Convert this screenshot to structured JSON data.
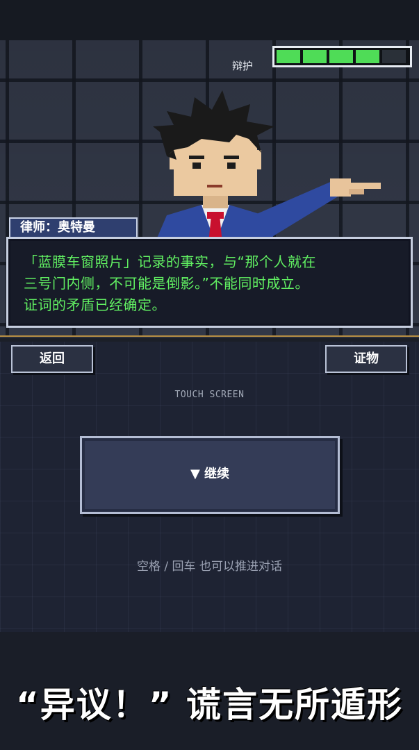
{
  "hud": {
    "defense_label": "辩护",
    "health_segments_total": 5,
    "health_segments_filled": 4,
    "health_color": "#4fdc57"
  },
  "dialog": {
    "speaker": "律师：奥特曼",
    "lines": [
      "「蓝膜车窗照片」记录的事实，与“那个人就在",
      "三号门内侧，不可能是倒影。”不能同时成立。",
      "证词的矛盾已经确定。"
    ],
    "text_color": "#61f062"
  },
  "controls": {
    "back_label": "返回",
    "evidence_label": "证物",
    "touch_hint": "TOUCH SCREEN",
    "continue_icon": "down-triangle-icon",
    "continue_label": "▼ 继续",
    "keyboard_hint": "空格 / 回车 也可以推进对话"
  },
  "banner": {
    "slogan": "“异议！” 谎言无所遁形"
  }
}
